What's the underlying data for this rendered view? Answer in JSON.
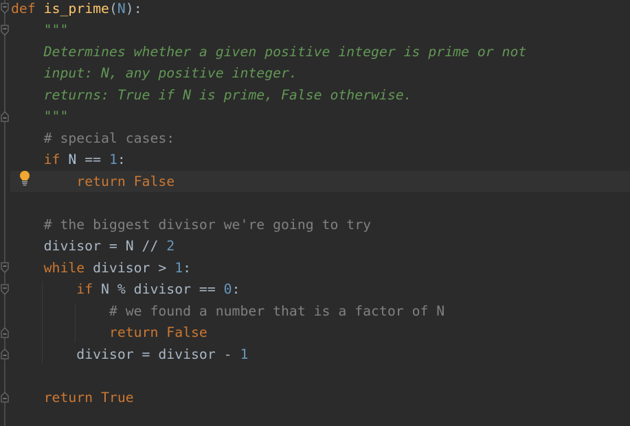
{
  "editor": {
    "language": "python",
    "current_line": 9,
    "lines": [
      {
        "n": 1,
        "tokens": [
          {
            "t": "def",
            "c": "kw"
          },
          {
            "t": " "
          },
          {
            "t": "is_prime",
            "c": "fn"
          },
          {
            "t": "("
          },
          {
            "t": "N",
            "c": "par"
          },
          {
            "t": "):"
          }
        ]
      },
      {
        "n": 2,
        "tokens": [
          {
            "t": "    "
          },
          {
            "t": "\"\"\"",
            "c": "doc"
          }
        ]
      },
      {
        "n": 3,
        "tokens": [
          {
            "t": "    "
          },
          {
            "t": "Determines whether a given positive integer is prime or not",
            "c": "doc"
          }
        ]
      },
      {
        "n": 4,
        "tokens": [
          {
            "t": "    "
          },
          {
            "t": "input: N, any positive integer.",
            "c": "doc"
          }
        ]
      },
      {
        "n": 5,
        "tokens": [
          {
            "t": "    "
          },
          {
            "t": "returns: True if N is prime, False otherwise.",
            "c": "doc"
          }
        ]
      },
      {
        "n": 6,
        "tokens": [
          {
            "t": "    "
          },
          {
            "t": "\"\"\"",
            "c": "doc"
          }
        ]
      },
      {
        "n": 7,
        "tokens": [
          {
            "t": "    "
          },
          {
            "t": "# special cases:",
            "c": "cmt"
          }
        ]
      },
      {
        "n": 8,
        "tokens": [
          {
            "t": "    "
          },
          {
            "t": "if",
            "c": "kw"
          },
          {
            "t": " "
          },
          {
            "t": "N",
            "c": "nm"
          },
          {
            "t": " == "
          },
          {
            "t": "1",
            "c": "num"
          },
          {
            "t": ":"
          }
        ]
      },
      {
        "n": 9,
        "tokens": [
          {
            "t": "        "
          },
          {
            "t": "return False",
            "c": "kw"
          }
        ]
      },
      {
        "n": 10,
        "tokens": []
      },
      {
        "n": 11,
        "tokens": [
          {
            "t": "    "
          },
          {
            "t": "# the biggest divisor we're going to try",
            "c": "cmt"
          }
        ]
      },
      {
        "n": 12,
        "tokens": [
          {
            "t": "    "
          },
          {
            "t": "divisor = N // "
          },
          {
            "t": "2",
            "c": "num"
          }
        ]
      },
      {
        "n": 13,
        "tokens": [
          {
            "t": "    "
          },
          {
            "t": "while",
            "c": "kw"
          },
          {
            "t": " divisor > "
          },
          {
            "t": "1",
            "c": "num"
          },
          {
            "t": ":"
          }
        ]
      },
      {
        "n": 14,
        "tokens": [
          {
            "t": "        "
          },
          {
            "t": "if",
            "c": "kw"
          },
          {
            "t": " N % divisor == "
          },
          {
            "t": "0",
            "c": "num"
          },
          {
            "t": ":"
          }
        ]
      },
      {
        "n": 15,
        "tokens": [
          {
            "t": "            "
          },
          {
            "t": "# we found a number that is a factor of N",
            "c": "cmt"
          }
        ]
      },
      {
        "n": 16,
        "tokens": [
          {
            "t": "            "
          },
          {
            "t": "return False",
            "c": "kw"
          }
        ]
      },
      {
        "n": 17,
        "tokens": [
          {
            "t": "        "
          },
          {
            "t": "divisor = divisor - "
          },
          {
            "t": "1",
            "c": "num"
          }
        ]
      },
      {
        "n": 18,
        "tokens": []
      },
      {
        "n": 19,
        "tokens": [
          {
            "t": "    "
          },
          {
            "t": "return True",
            "c": "kw"
          }
        ]
      }
    ],
    "fold_markers": [
      {
        "line": 1,
        "type": "fold-open"
      },
      {
        "line": 2,
        "type": "fold-open"
      },
      {
        "line": 6,
        "type": "fold-close"
      },
      {
        "line": 13,
        "type": "fold-open"
      },
      {
        "line": 14,
        "type": "fold-open"
      },
      {
        "line": 16,
        "type": "fold-close"
      },
      {
        "line": 17,
        "type": "fold-close"
      },
      {
        "line": 19,
        "type": "fold-close"
      }
    ],
    "intention_icon": {
      "line": 9,
      "icon": "lightbulb-icon",
      "color": "#f0a732"
    }
  }
}
